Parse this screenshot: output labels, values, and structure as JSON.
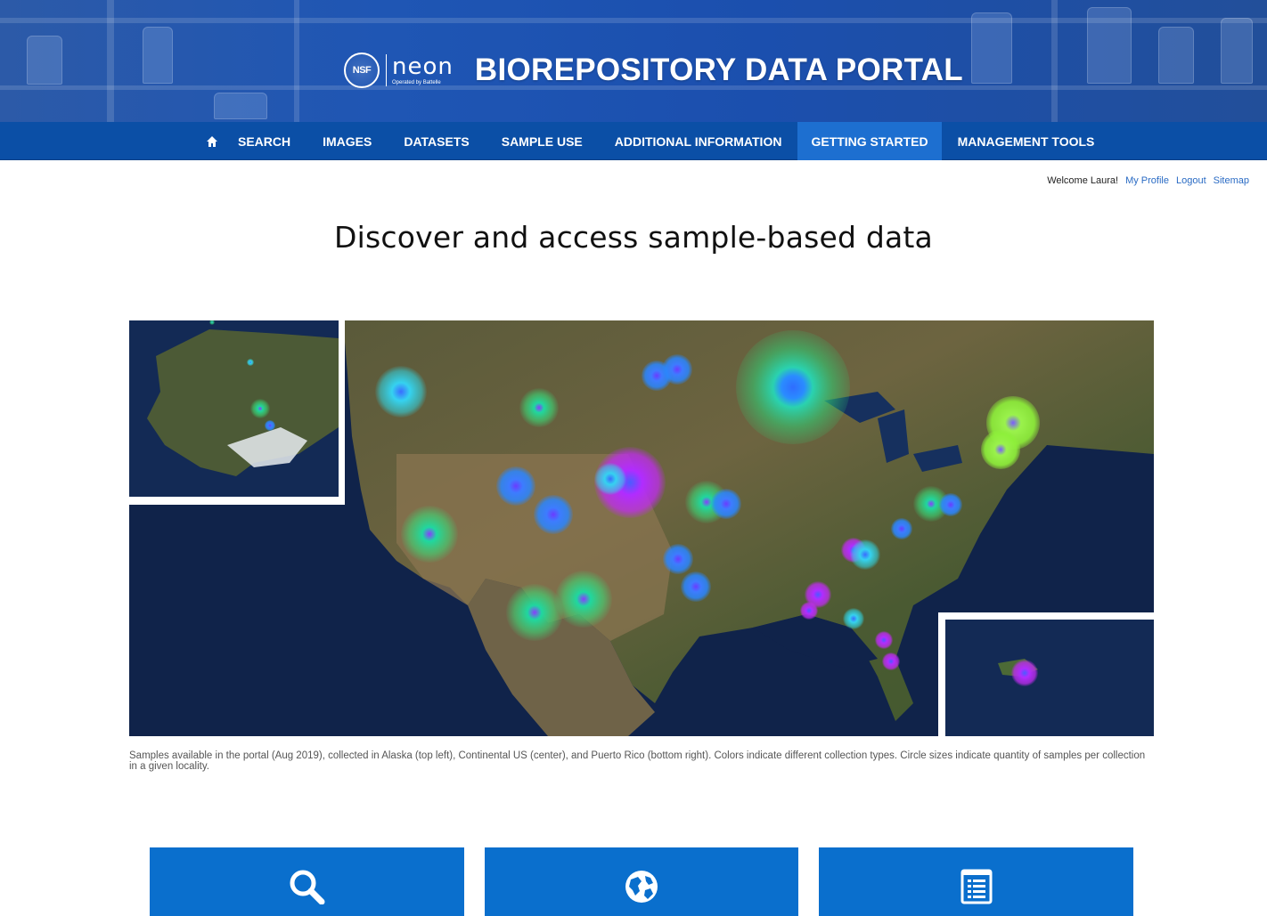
{
  "brand": {
    "nsf_logo_text": "NSF",
    "neon_word": "neon",
    "neon_sub": "Operated by Battelle",
    "title": "BIOREPOSITORY DATA PORTAL"
  },
  "nav": {
    "home_icon": "home-icon",
    "items": [
      {
        "label": "SEARCH"
      },
      {
        "label": "IMAGES"
      },
      {
        "label": "DATASETS"
      },
      {
        "label": "SAMPLE USE"
      },
      {
        "label": "ADDITIONAL INFORMATION"
      },
      {
        "label": "GETTING STARTED",
        "active": true
      },
      {
        "label": "MANAGEMENT TOOLS"
      }
    ]
  },
  "user": {
    "welcome": "Welcome Laura!",
    "links": [
      "My Profile",
      "Logout",
      "Sitemap"
    ]
  },
  "headline": "Discover and access sample-based data",
  "map": {
    "caption": "Samples available in the portal (Aug 2019), collected in Alaska (top left), Continental US (center), and Puerto Rico (bottom right). Colors indicate different collection types. Circle sizes indicate quantity of samples per collection in a given locality."
  },
  "tiles": [
    {
      "icon": "search-icon"
    },
    {
      "icon": "globe-icon"
    },
    {
      "icon": "list-document-icon"
    }
  ],
  "colors": {
    "nav_bg": "#0b4fa6",
    "nav_active": "#1d6fd0",
    "tile_bg": "#0a6fcd",
    "link": "#2a6bc4"
  }
}
